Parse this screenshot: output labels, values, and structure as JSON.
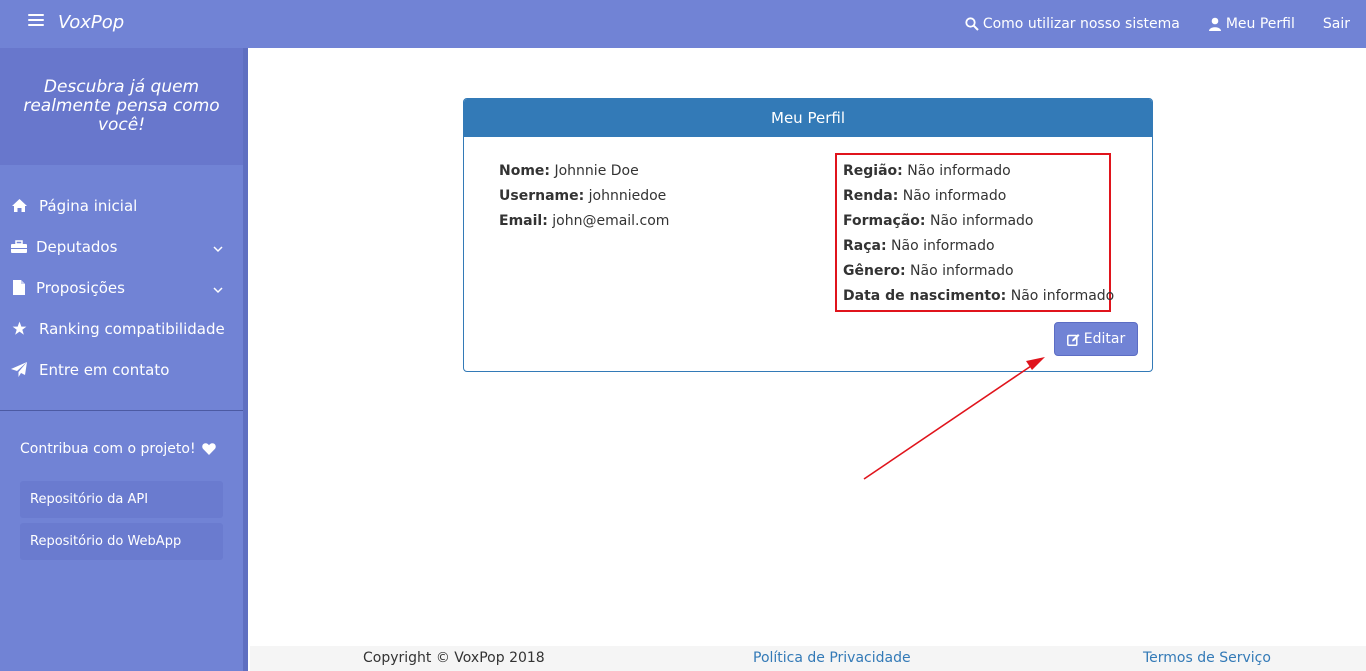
{
  "navbar": {
    "brand": "VoxPop",
    "help_label": "Como utilizar nosso sistema",
    "profile_label": "Meu Perfil",
    "logout_label": "Sair"
  },
  "sidebar": {
    "tagline": "Descubra já quem realmente pensa como você!",
    "items": [
      {
        "label": "Página inicial",
        "icon": "home-icon"
      },
      {
        "label": "Deputados",
        "icon": "briefcase-icon",
        "expandable": true
      },
      {
        "label": "Proposições",
        "icon": "file-icon",
        "expandable": true
      },
      {
        "label": "Ranking compatibilidade",
        "icon": "star-icon"
      },
      {
        "label": "Entre em contato",
        "icon": "send-icon"
      }
    ],
    "contribute_label": "Contribua com o projeto!",
    "repo_api_label": "Repositório da API",
    "repo_webapp_label": "Repositório do WebApp"
  },
  "profile": {
    "title": "Meu Perfil",
    "left": [
      {
        "label": "Nome:",
        "value": "Johnnie Doe"
      },
      {
        "label": "Username:",
        "value": "johnniedoe"
      },
      {
        "label": "Email:",
        "value": "john@email.com"
      }
    ],
    "right": [
      {
        "label": "Região:",
        "value": "Não informado"
      },
      {
        "label": "Renda:",
        "value": "Não informado"
      },
      {
        "label": "Formação:",
        "value": "Não informado"
      },
      {
        "label": "Raça:",
        "value": "Não informado"
      },
      {
        "label": "Gênero:",
        "value": "Não informado"
      },
      {
        "label": "Data de nascimento:",
        "value": "Não informado"
      }
    ],
    "edit_label": "Editar"
  },
  "footer": {
    "copyright": "Copyright © VoxPop 2018",
    "privacy": "Política de Privacidade",
    "terms": "Termos de Serviço"
  },
  "colors": {
    "primary": "#7183d5",
    "card_header": "#337ab7",
    "annotation": "#e0141c"
  }
}
